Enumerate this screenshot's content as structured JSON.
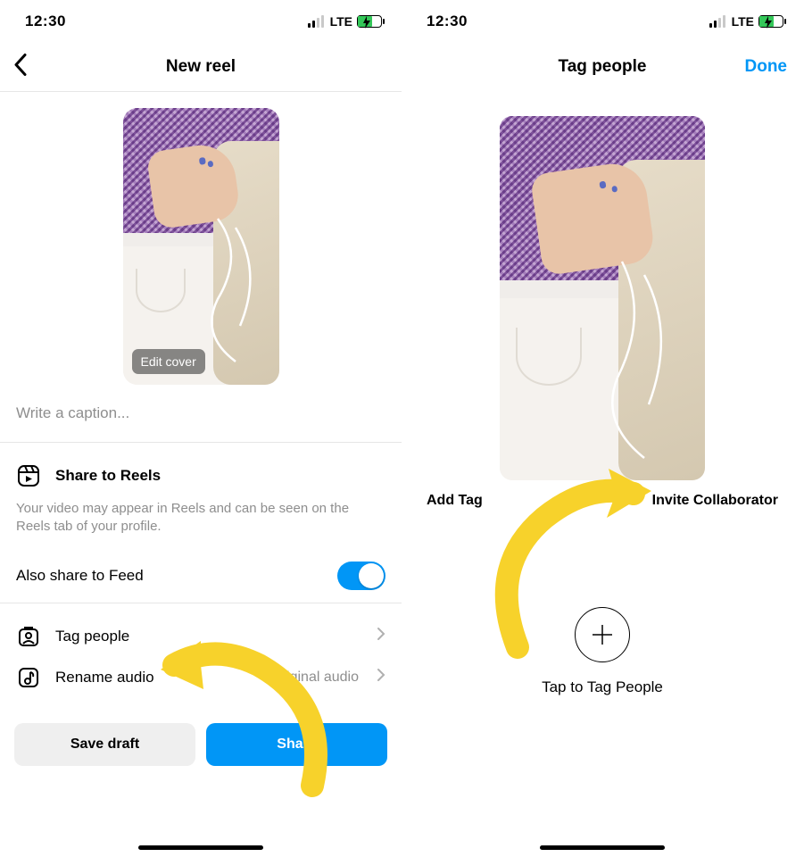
{
  "status": {
    "time": "12:30",
    "network": "LTE"
  },
  "left_screen": {
    "title": "New reel",
    "edit_cover": "Edit cover",
    "caption_placeholder": "Write a caption...",
    "share_to_reels": "Share to Reels",
    "share_to_reels_sub": "Your video may appear in Reels and can be seen on the Reels tab of your profile.",
    "also_share_feed": "Also share to Feed",
    "tag_people": "Tag people",
    "rename_audio": "Rename audio",
    "audio_value": "Original audio",
    "save_draft": "Save draft",
    "share": "Share"
  },
  "right_screen": {
    "title": "Tag people",
    "done": "Done",
    "add_tag": "Add Tag",
    "invite_collab": "Invite Collaborator",
    "tap_to_tag": "Tap to Tag People"
  },
  "colors": {
    "accent": "#0196f6",
    "arrow": "#f7d22b"
  }
}
